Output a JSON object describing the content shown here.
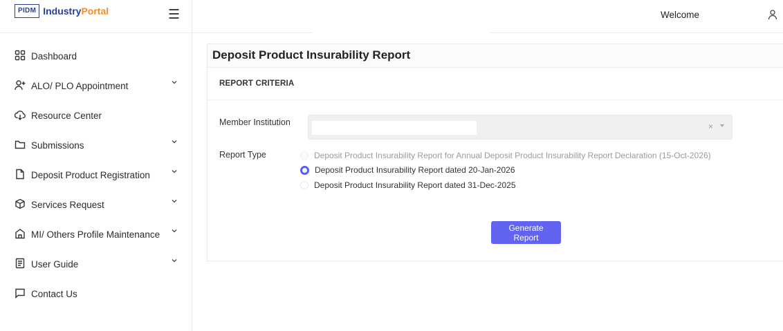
{
  "brand": {
    "logo_box": "PIDM",
    "name_part1": "Industry",
    "name_part2": "Portal",
    "primary_color": "#2a3f8f",
    "accent_color": "#f28c28"
  },
  "header": {
    "welcome": "Welcome",
    "menu_icon": "hamburger-icon",
    "user_icon": "user-icon"
  },
  "sidebar": {
    "items": [
      {
        "label": "Dashboard",
        "icon": "grid-icon",
        "expandable": false
      },
      {
        "label": "ALO/ PLO Appointment",
        "icon": "user-plus-icon",
        "expandable": true
      },
      {
        "label": "Resource Center",
        "icon": "cloud-download-icon",
        "expandable": false
      },
      {
        "label": "Submissions",
        "icon": "folder-icon",
        "expandable": true
      },
      {
        "label": "Deposit Product Registration",
        "icon": "file-icon",
        "expandable": true
      },
      {
        "label": "Services Request",
        "icon": "box-icon",
        "expandable": true
      },
      {
        "label": "MI/ Others Profile Maintenance",
        "icon": "home-icon",
        "expandable": true
      },
      {
        "label": "User Guide",
        "icon": "document-icon",
        "expandable": true
      },
      {
        "label": "Contact Us",
        "icon": "message-icon",
        "expandable": false
      }
    ]
  },
  "page": {
    "title": "Deposit Product Insurability Report",
    "section_title": "REPORT CRITERIA",
    "member_institution_label": "Member Institution",
    "member_institution_value": "",
    "report_type_label": "Report Type",
    "report_types": [
      {
        "label": "Deposit Product Insurability Report for Annual Deposit Product Insurability Report Declaration (15-Oct-2026)",
        "state": "disabled"
      },
      {
        "label": "Deposit Product Insurability Report dated 20-Jan-2026",
        "state": "checked"
      },
      {
        "label": "Deposit Product Insurability Report dated 31-Dec-2025",
        "state": "unchecked"
      }
    ],
    "generate_button": "Generate Report",
    "button_color": "#6264f1"
  }
}
